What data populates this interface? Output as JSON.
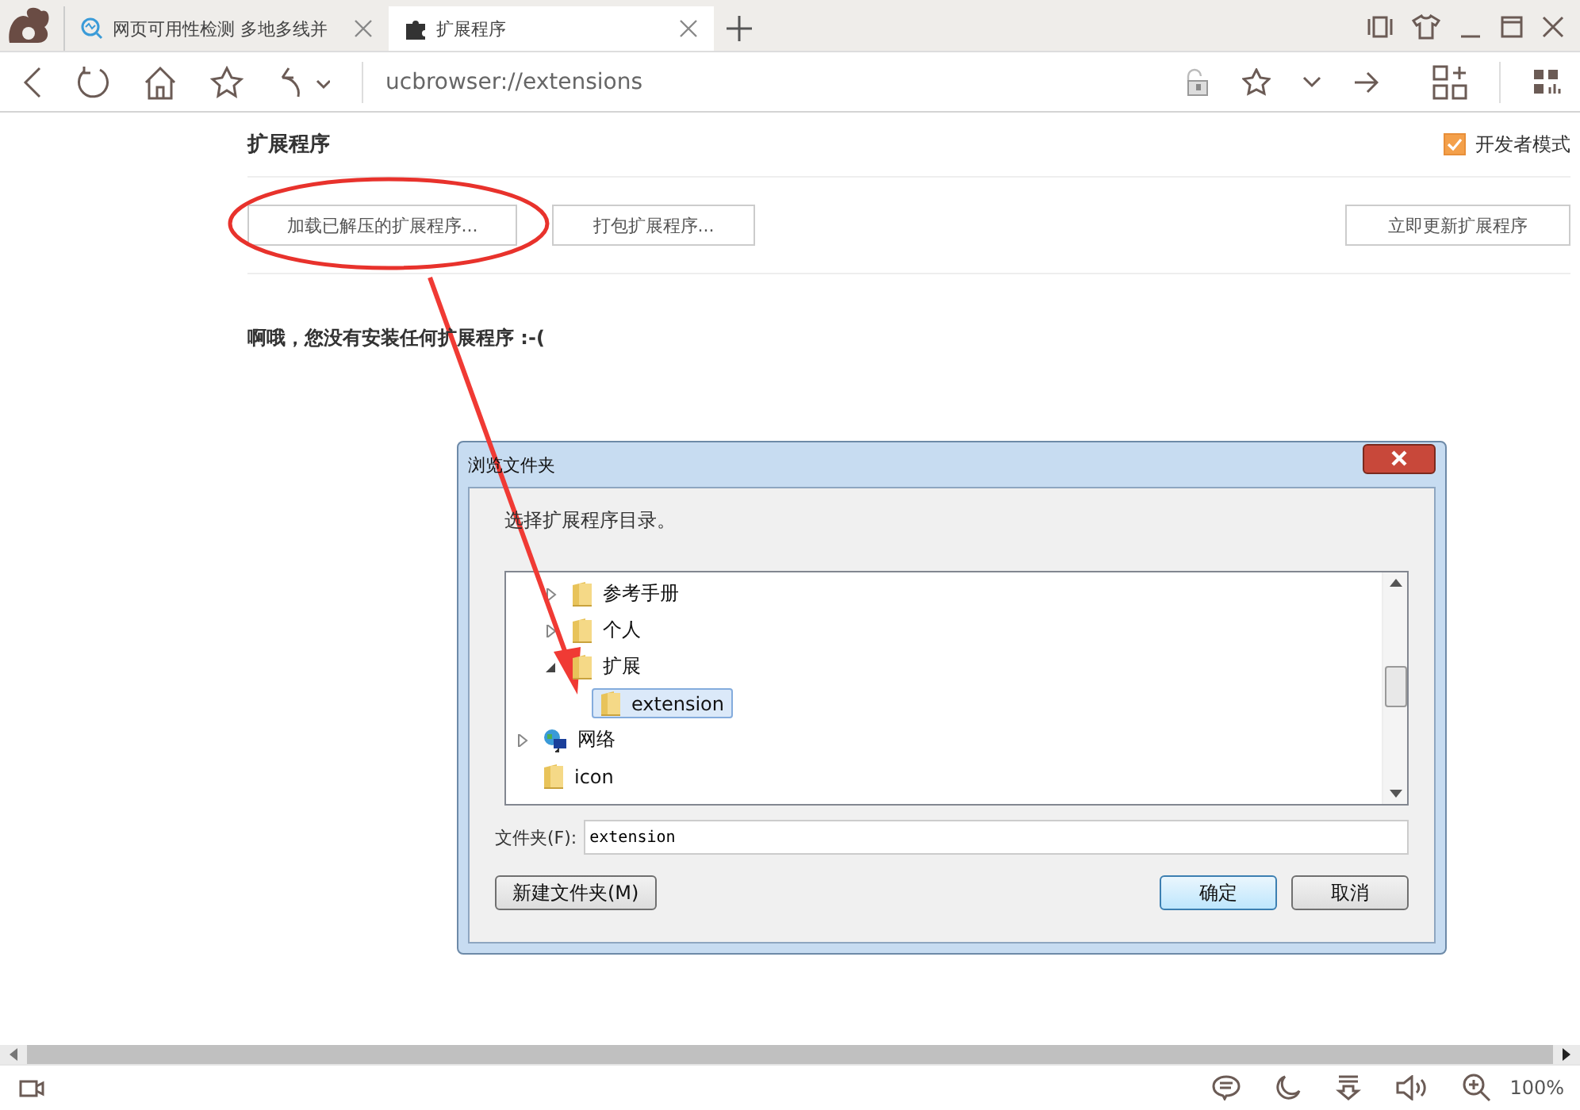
{
  "tabs": [
    {
      "label": "网页可用性检测 多地多线并",
      "selected": false,
      "kind": "monitor"
    },
    {
      "label": "扩展程序",
      "selected": true,
      "kind": "puzzle"
    }
  ],
  "address": "ucbrowser://extensions",
  "page": {
    "title": "扩展程序",
    "developer_mode": {
      "label": "开发者模式",
      "checked": true
    },
    "buttons": [
      "加载已解压的扩展程序...",
      "打包扩展程序..."
    ],
    "update_button": "立即更新扩展程序",
    "empty_message": "啊哦，您没有安装任何扩展程序 :-("
  },
  "dialog": {
    "title": "浏览文件夹",
    "prompt": "选择扩展程序目录。",
    "tree": {
      "scrolled_group": [
        {
          "label": "参考手册",
          "kind": "folder",
          "expandable": true,
          "expanded": false,
          "selected": false
        },
        {
          "label": "个人",
          "kind": "folder",
          "expandable": true,
          "expanded": false,
          "selected": false
        },
        {
          "label": "扩展",
          "kind": "folder",
          "expandable": true,
          "expanded": true,
          "selected": false,
          "children": [
            {
              "label": "extension",
              "kind": "folder",
              "expandable": false,
              "selected": true
            }
          ]
        }
      ],
      "items": [
        {
          "label": "网络",
          "kind": "network",
          "expandable": true,
          "expanded": false,
          "selected": false
        },
        {
          "label": "icon",
          "kind": "folder",
          "expandable": false,
          "selected": false
        }
      ]
    },
    "folder_label": "文件夹(F):",
    "folder_value": "extension",
    "new_folder_button": "新建文件夹(M)",
    "ok_button": "确定",
    "cancel_button": "取消"
  },
  "status_bar": {
    "zoom": "100%"
  }
}
